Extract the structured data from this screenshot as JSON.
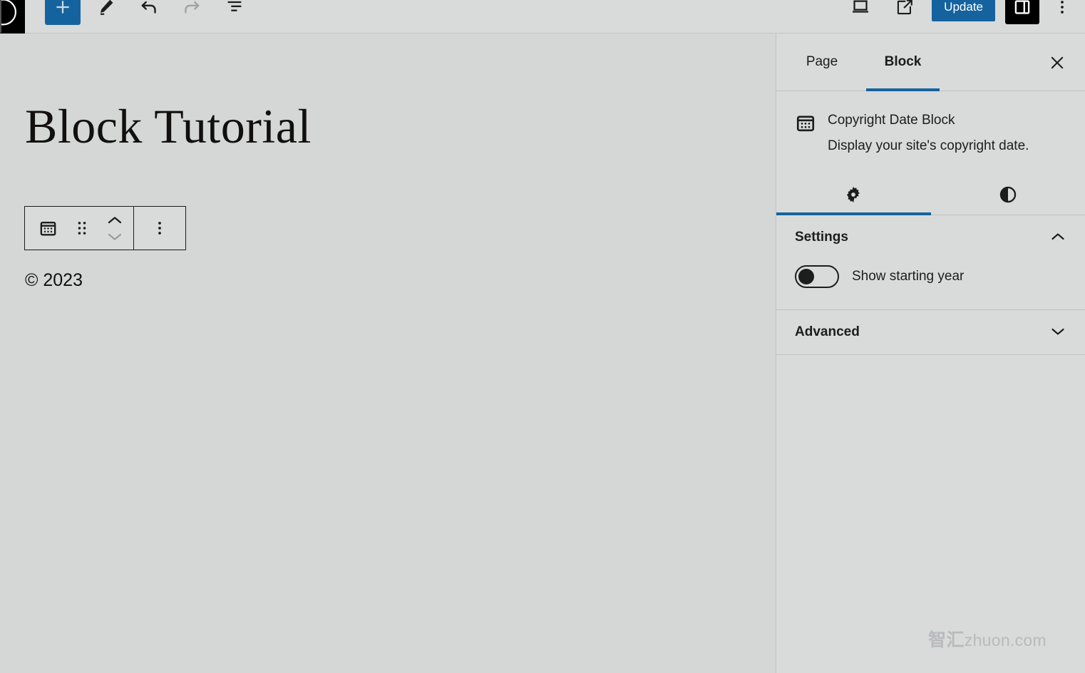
{
  "header": {
    "logo_icon": "wordpress-logo-icon",
    "tools": [
      {
        "name": "add-block-button",
        "icon": "plus-icon",
        "label": "Toggle block inserter"
      },
      {
        "name": "tools-button",
        "icon": "pencil-icon",
        "label": "Tools"
      },
      {
        "name": "undo-button",
        "icon": "undo-arrow-icon",
        "label": "Undo"
      },
      {
        "name": "redo-button",
        "icon": "redo-arrow-icon",
        "label": "Redo"
      },
      {
        "name": "list-view-button",
        "icon": "list-view-icon",
        "label": "Document overview"
      }
    ],
    "right_tools": [
      {
        "name": "preview-button",
        "icon": "desktop-icon",
        "label": "Preview"
      },
      {
        "name": "view-site-button",
        "icon": "external-link-icon",
        "label": "View site"
      }
    ],
    "update_label": "Update",
    "settings_toggle_icon": "sidebar-panel-icon",
    "more_options_icon": "three-dots-vertical-icon",
    "accent_color": "#15639e"
  },
  "canvas": {
    "post_title": "Block Tutorial",
    "block_toolbar": {
      "block_type_icon": "calendar-icon",
      "drag_handle_icon": "six-dots-drag-icon",
      "move_up_icon": "chevron-up-icon",
      "move_down_icon": "chevron-down-icon",
      "options_icon": "three-dots-vertical-icon"
    },
    "block_content": "© 2023"
  },
  "sidebar": {
    "tabs": [
      {
        "label": "Page",
        "active": false
      },
      {
        "label": "Block",
        "active": true
      }
    ],
    "close_icon": "close-x-icon",
    "block": {
      "icon": "calendar-icon",
      "title": "Copyright Date Block",
      "description": "Display your site's copyright date."
    },
    "subtabs": [
      {
        "name": "settings-subtab",
        "icon": "gear-icon",
        "active": true
      },
      {
        "name": "styles-subtab",
        "icon": "half-circle-contrast-icon",
        "active": false
      }
    ],
    "sections": [
      {
        "title": "Settings",
        "expanded": true,
        "chevron": "chevron-up-icon",
        "controls": [
          {
            "type": "toggle",
            "label": "Show starting year",
            "value": false
          }
        ]
      },
      {
        "title": "Advanced",
        "expanded": false,
        "chevron": "chevron-down-icon",
        "controls": []
      }
    ]
  },
  "watermark": {
    "cjk": "智汇",
    "domain": "zhuon.com"
  }
}
